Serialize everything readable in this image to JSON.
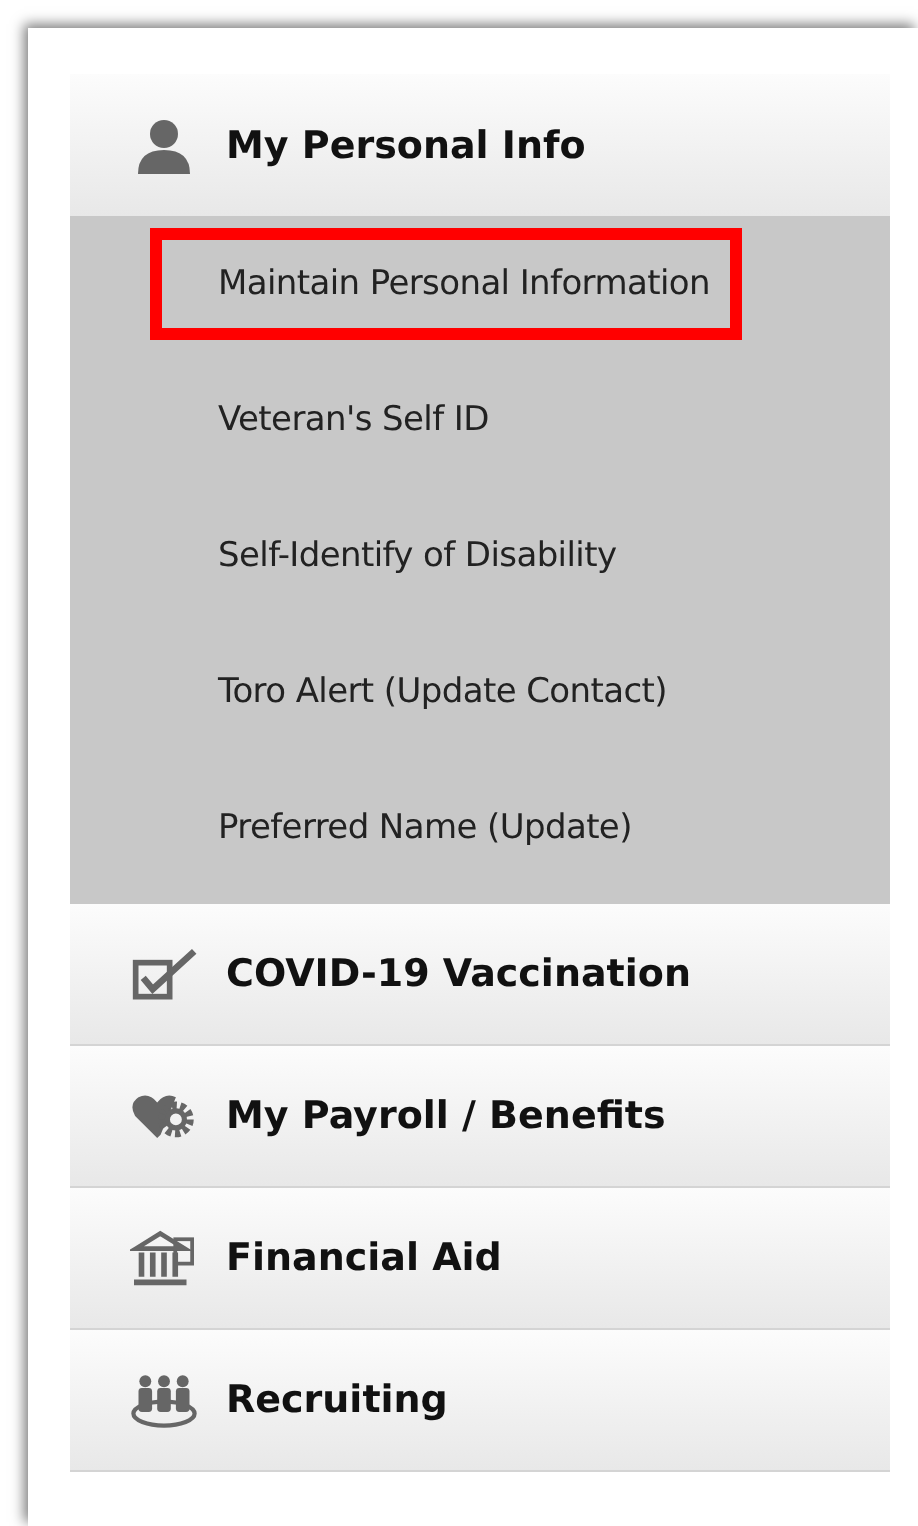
{
  "menu": [
    {
      "label": "My Personal Info",
      "expanded": true,
      "children": [
        {
          "label": "Maintain Personal Information",
          "highlighted": true
        },
        {
          "label": "Veteran's Self ID",
          "highlighted": false
        },
        {
          "label": "Self-Identify of Disability",
          "highlighted": false
        },
        {
          "label": "Toro Alert (Update Contact)",
          "highlighted": false
        },
        {
          "label": "Preferred Name (Update)",
          "highlighted": false
        }
      ]
    },
    {
      "label": "COVID-19 Vaccination",
      "expanded": false
    },
    {
      "label": "My Payroll / Benefits",
      "expanded": false
    },
    {
      "label": "Financial Aid",
      "expanded": false
    },
    {
      "label": "Recruiting",
      "expanded": false
    }
  ]
}
